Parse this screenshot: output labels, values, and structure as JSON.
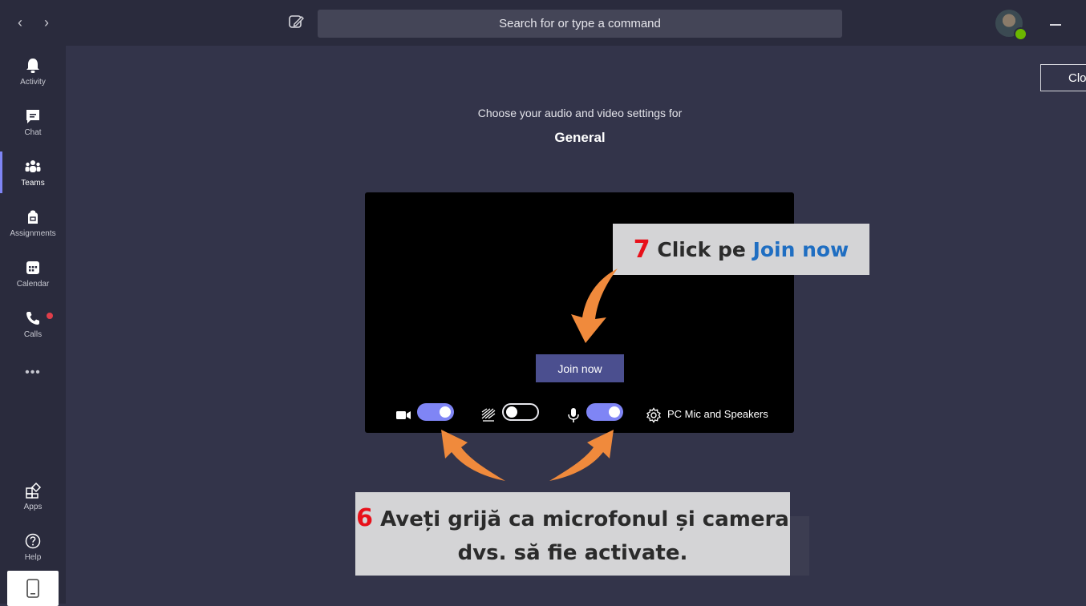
{
  "titlebar": {
    "back_label": "‹",
    "forward_label": "›",
    "search_placeholder": "Search for or type a command"
  },
  "rail": {
    "items": [
      {
        "label": "Activity",
        "icon": "bell-icon"
      },
      {
        "label": "Chat",
        "icon": "chat-icon"
      },
      {
        "label": "Teams",
        "icon": "teams-icon",
        "active": true
      },
      {
        "label": "Assignments",
        "icon": "backpack-icon"
      },
      {
        "label": "Calendar",
        "icon": "calendar-icon"
      },
      {
        "label": "Calls",
        "icon": "phone-icon",
        "badge": true
      },
      {
        "label": "•••",
        "icon": "more-icon"
      },
      {
        "label": "Apps",
        "icon": "apps-icon"
      },
      {
        "label": "Help",
        "icon": "help-icon"
      }
    ]
  },
  "meeting": {
    "close_label": "Clo",
    "prompt": "Choose your audio and video settings for",
    "channel": "General",
    "join_label": "Join now",
    "audio_device": "PC Mic and Speakers",
    "camera_on": true,
    "blur_on": false,
    "mic_on": true
  },
  "annotations": {
    "step7_number": "7",
    "step7_text": " Click pe ",
    "step7_highlight": "Join now",
    "step6_number": "6",
    "step6_line1": " Aveți grijă ca microfonul și camera",
    "step6_line2": "dvs. să fie activate."
  },
  "colors": {
    "background": "#33344a",
    "rail": "#2a2b3d",
    "accent": "#7f85f5",
    "arrow": "#f08a3c",
    "callout": "#d4d4d6",
    "step_number": "#e8101a"
  }
}
